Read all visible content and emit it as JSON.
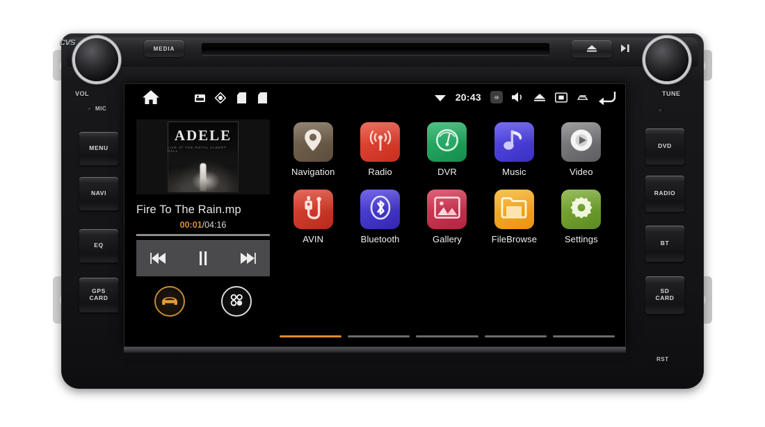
{
  "device": {
    "brand_logo": "cvs",
    "top": {
      "media_button": "MEDIA",
      "eject_icon": "eject-icon",
      "playpause_icon": "play-pause-icon"
    },
    "left_controls": {
      "knob_label": "VOL",
      "mic_label": "MIC",
      "buttons": [
        "MENU",
        "NAVI",
        "EQ",
        "GPS\nCARD"
      ]
    },
    "right_controls": {
      "knob_label": "TUNE",
      "buttons": [
        "DVD",
        "RADIO",
        "BT",
        "SD\nCARD"
      ],
      "reset_label": "RST"
    }
  },
  "screen": {
    "statusbar": {
      "home_icon": "home-icon",
      "left_icons": [
        "sd-card-icon",
        "disc-icon",
        "storage-icon",
        "storage-icon"
      ],
      "wifi_icon": "wifi-icon",
      "clock": "20:43",
      "right_icons": [
        {
          "name": "dashcam-icon",
          "highlighted": true
        },
        {
          "name": "volume-icon",
          "highlighted": false
        },
        {
          "name": "eject-icon",
          "highlighted": false
        },
        {
          "name": "screen-off-icon",
          "highlighted": false
        },
        {
          "name": "car-link-icon",
          "highlighted": false
        },
        {
          "name": "back-arrow-icon",
          "highlighted": false
        }
      ]
    },
    "music_widget": {
      "album_title": "ADELE",
      "album_subtitle": "LIVE AT THE ROYAL ALBERT HALL",
      "track_name": "Fire To The Rain.mp",
      "time_current": "00:01",
      "time_separator": "/",
      "time_total": "04:16",
      "progress_percent": 0.4,
      "controls": [
        {
          "name": "previous-track-button",
          "glyph": "⏮"
        },
        {
          "name": "pause-button",
          "glyph": "▐▌"
        },
        {
          "name": "next-track-button",
          "glyph": "⏭"
        }
      ],
      "shortcut_buttons": [
        {
          "name": "car-mode-button",
          "icon": "car-icon",
          "color": "#e8a033"
        },
        {
          "name": "all-apps-button",
          "icon": "apps-dots-icon",
          "color": "#ffffff"
        }
      ]
    },
    "apps": [
      {
        "label": "Navigation",
        "icon": "map-pin-icon",
        "bg": "#6b5a48",
        "fg": "#efe9e2"
      },
      {
        "label": "Radio",
        "icon": "radio-wave-icon",
        "bg": "#d93b2b",
        "fg": "#ffd9d3"
      },
      {
        "label": "DVR",
        "icon": "gauge-icon",
        "bg": "#1e9c5a",
        "fg": "#e4f6ea"
      },
      {
        "label": "Music",
        "icon": "music-note-icon",
        "bg": "#4a3fdb",
        "fg": "#cfc8ff"
      },
      {
        "label": "Video",
        "icon": "play-circle-icon",
        "bg": "#6e6e70",
        "fg": "#f2f2f2"
      },
      {
        "label": "AVIN",
        "icon": "usb-plug-icon",
        "bg": "#cf3a2c",
        "fg": "#ffe0da"
      },
      {
        "label": "Bluetooth",
        "icon": "bluetooth-icon",
        "bg": "#4335cf",
        "fg": "#e4e1ff"
      },
      {
        "label": "Gallery",
        "icon": "photo-icon",
        "bg": "#c9314f",
        "fg": "#ffd8de"
      },
      {
        "label": "FileBrowse",
        "icon": "folder-icon",
        "bg": "#f0a020",
        "fg": "#fff0cf"
      },
      {
        "label": "Settings",
        "icon": "gear-icon",
        "bg": "#6e9c2e",
        "fg": "#edf6d9"
      }
    ],
    "page_indicator": {
      "total": 5,
      "active_index": 0,
      "active_color": "#e08a2e",
      "inactive_color": "#6c6c6c"
    }
  }
}
